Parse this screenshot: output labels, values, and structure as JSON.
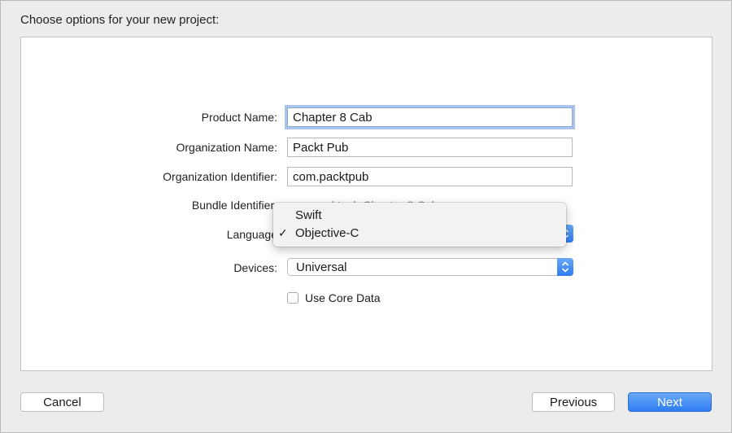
{
  "dialog": {
    "heading": "Choose options for your new project:"
  },
  "form": {
    "product_name": {
      "label": "Product Name:",
      "value": "Chapter 8 Cab"
    },
    "organization_name": {
      "label": "Organization Name:",
      "value": "Packt Pub"
    },
    "organization_identifier": {
      "label": "Organization Identifier:",
      "value": "com.packtpub"
    },
    "bundle_identifier": {
      "label": "Bundle Identifier:",
      "value": "com.packtpub.Chapter-8-Cab"
    },
    "language": {
      "label": "Language",
      "options": [
        {
          "label": "Swift",
          "checked": false
        },
        {
          "label": "Objective-C",
          "checked": true
        }
      ],
      "check_glyph": "✓"
    },
    "devices": {
      "label": "Devices:",
      "value": "Universal"
    },
    "use_core_data": {
      "label": "Use Core Data",
      "checked": false
    }
  },
  "buttons": {
    "cancel": "Cancel",
    "previous": "Previous",
    "next": "Next"
  },
  "colors": {
    "accent": "#2f7df2",
    "focus_ring": "#a9c5ec"
  }
}
